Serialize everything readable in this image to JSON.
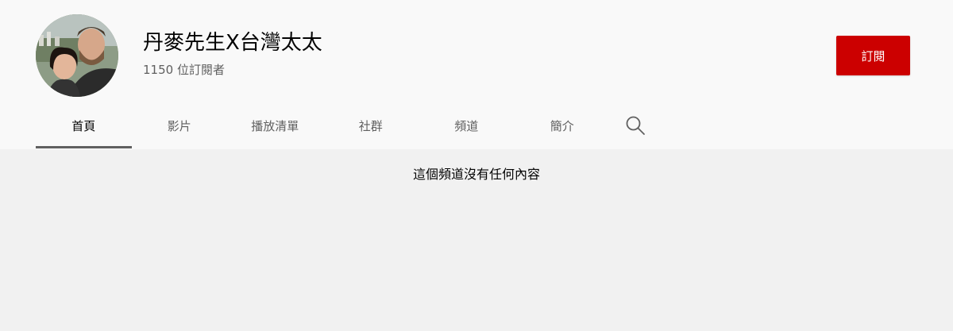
{
  "channel": {
    "name": "丹麥先生X台灣太太",
    "subscribers": "1150 位訂閱者",
    "subscribe_label": "訂閱",
    "subscribe_color": "#cc0000"
  },
  "tabs": [
    {
      "label": "首頁",
      "active": true
    },
    {
      "label": "影片",
      "active": false
    },
    {
      "label": "播放清單",
      "active": false
    },
    {
      "label": "社群",
      "active": false
    },
    {
      "label": "頻道",
      "active": false
    },
    {
      "label": "簡介",
      "active": false
    }
  ],
  "search_icon": "search-icon",
  "content": {
    "empty_message": "這個頻道沒有任何內容"
  }
}
